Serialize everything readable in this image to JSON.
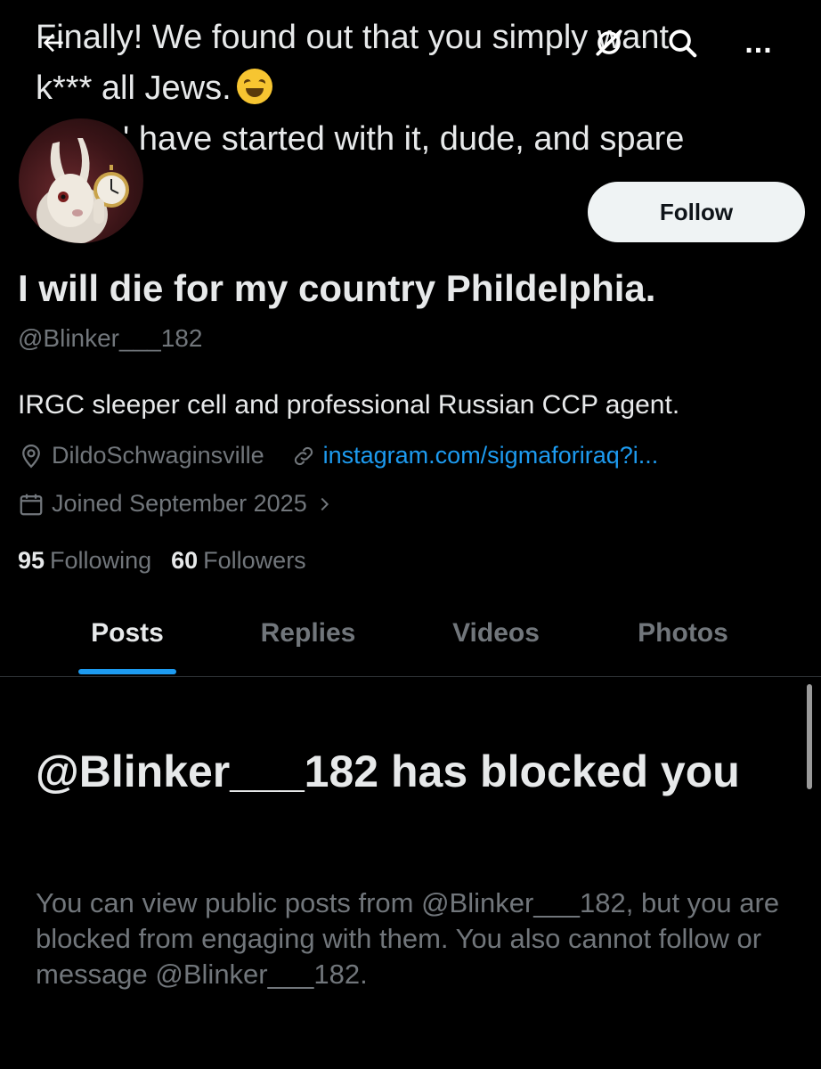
{
  "banner": {
    "text_lines": [
      "Finally! We found out that you simply want",
      "k*** all Jews.",
      "' have started with it, dude, and spare"
    ]
  },
  "nav": {
    "back_icon": "arrow-left-icon",
    "grok_icon": "grok-icon",
    "search_icon": "search-icon",
    "more_label": "..."
  },
  "profile": {
    "follow_label": "Follow",
    "display_name": "I will die for my country Phildelphia.",
    "handle": "@Blinker___182",
    "bio": "IRGC sleeper cell and professional Russian CCP agent.",
    "location": "DildoSchwaginsville",
    "link": "instagram.com/sigmaforiraq?i...",
    "joined": "Joined September 2025",
    "following_count": "95",
    "following_label": "Following",
    "followers_count": "60",
    "followers_label": "Followers"
  },
  "tabs": [
    {
      "label": "Posts",
      "active": true
    },
    {
      "label": "Replies",
      "active": false
    },
    {
      "label": "Videos",
      "active": false
    },
    {
      "label": "Photos",
      "active": false
    }
  ],
  "blocked": {
    "title": "@Blinker___182 has blocked you",
    "description": "You can view public posts from @Blinker___182, but you are blocked from engaging with them. You also cannot follow or message @Blinker___182."
  },
  "colors": {
    "background": "#000000",
    "text_primary": "#e7e9ea",
    "text_secondary": "#71767b",
    "accent": "#1d9bf0",
    "follow_button_bg": "#eff3f4"
  }
}
